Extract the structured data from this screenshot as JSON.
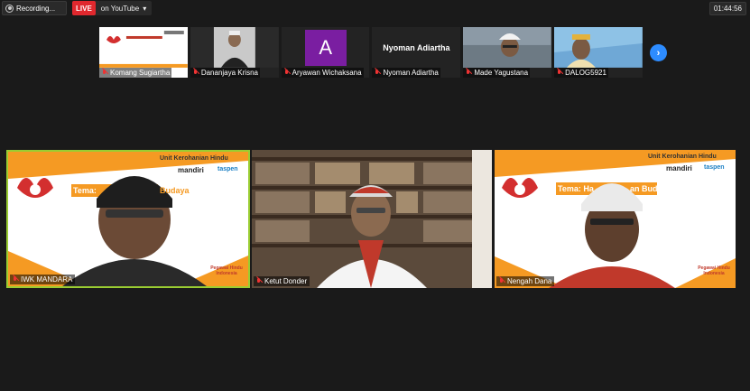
{
  "topbar": {
    "recording_label": "Recording...",
    "live_badge": "LIVE",
    "stream_target": "on YouTube",
    "timer": "01:44:56"
  },
  "strip": {
    "participants": [
      {
        "name": "Komang Sugiartha"
      },
      {
        "name": "Dananjaya Krisna"
      },
      {
        "name": "Aryawan Wichaksana",
        "avatar_letter": "A"
      },
      {
        "name": "Nyoman Adiartha",
        "display_name": "Nyoman Adiartha"
      },
      {
        "name": "Made Yagustana"
      },
      {
        "name": "DALOG5921"
      }
    ]
  },
  "tiles": [
    {
      "name": "IWK MANDARA",
      "unit": "Unit Kerohanian Hindu",
      "title": "Tema:",
      "title_suffix": "Budaya",
      "bank": "mandiri",
      "insurer": "taspen",
      "footer": "Pegawai Hindu Indonesia"
    },
    {
      "name": "Ketut Donder"
    },
    {
      "name": "Nengah Dana",
      "unit": "Unit Kerohanian Hindu",
      "title": "Tema: Ha",
      "title_suffix": "an Budaya",
      "bank": "mandiri",
      "insurer": "taspen",
      "footer": "Pegawai Hindu Indonesia"
    }
  ],
  "colors": {
    "active_speaker_border": "#9acd32",
    "live_red": "#e0282e",
    "accent_blue": "#2d8cff",
    "banner_orange": "#f59a23",
    "avatar_purple": "#7a1ea1"
  }
}
